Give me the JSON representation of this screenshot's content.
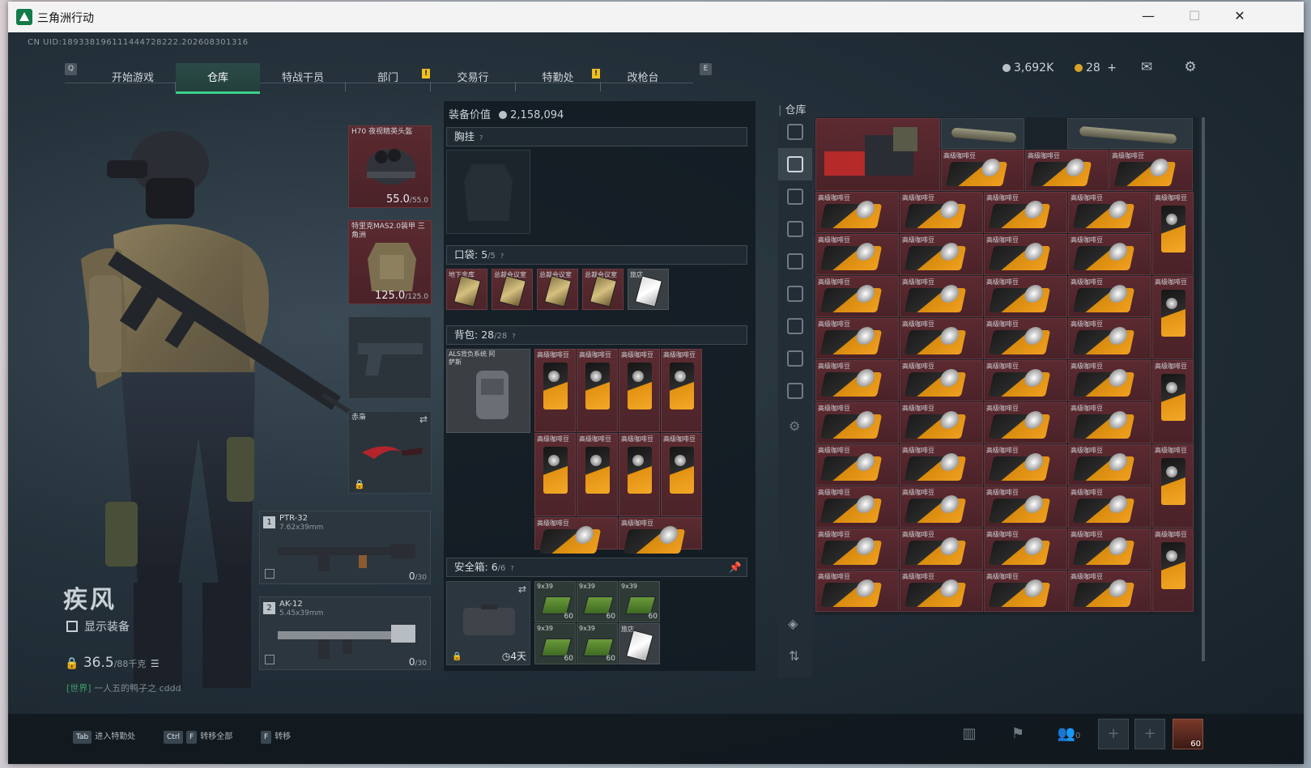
{
  "window": {
    "title": "三角洲行动",
    "min": "—",
    "max": "☐",
    "close": "✕"
  },
  "uid": "CN UID:189338196111444728222.202608301316",
  "nav": {
    "key_left": "Q",
    "key_right": "E",
    "tabs": [
      "开始游戏",
      "仓库",
      "特战干员",
      "部门",
      "交易行",
      "特勤处",
      "改枪台"
    ],
    "active": 1,
    "badge": "!"
  },
  "currency": {
    "silver": "3,692K",
    "gold": "28",
    "plus": "+"
  },
  "character": {
    "name": "疾风",
    "show_equipment": "显示装备",
    "weight": "36.5",
    "weight_max": "/88千克",
    "trade_hint": "[世界]",
    "trade_user": "一人五的鸭子之 cddd"
  },
  "gear": {
    "helmet": {
      "label": "H70 夜视精英头盔",
      "dur": "55.0",
      "max": "/55.0"
    },
    "armor": {
      "label": "特里克MAS2.0装甲 三角洲",
      "dur": "125.0",
      "max": "/125.0"
    },
    "melee": {
      "label": "赤枭"
    }
  },
  "weapons": [
    {
      "num": "1",
      "name": "PTR-32",
      "cal": "7.62x39mm",
      "ammo": "0",
      "max": "/30"
    },
    {
      "num": "2",
      "name": "AK-12",
      "cal": "5.45x39mm",
      "ammo": "0",
      "max": "/30"
    }
  ],
  "equip": {
    "value_label": "装备价值",
    "value": "2,158,094",
    "chest": "胸挂",
    "pockets_label": "口袋:",
    "pockets": "5",
    "pockets_max": "/5",
    "pocket_items": [
      "地下金库",
      "总裁会议室",
      "总裁会议室",
      "总裁会议室",
      "旅店"
    ],
    "backpack_label": "背包:",
    "backpack": "28",
    "backpack_max": "/28",
    "backpack_name": "ALS背负系统 阿萨斯",
    "bean_label": "高级咖啡豆",
    "safe_label": "安全箱:",
    "safe": "6",
    "safe_max": "/6",
    "safe_time": "4天",
    "safe_items": [
      {
        "t": "9x39",
        "n": "60"
      },
      {
        "t": "9x39",
        "n": "60"
      },
      {
        "t": "9x39",
        "n": "60"
      },
      {
        "t": "9x39",
        "n": "60"
      },
      {
        "t": "9x39",
        "n": "60"
      },
      {
        "t": "旅店",
        "n": ""
      }
    ]
  },
  "warehouse": {
    "title": "仓库",
    "bean_label": "高级咖啡豆"
  },
  "bottom": {
    "tab_key": "Tab",
    "tab_label": "进入特勤处",
    "ctrl_key": "Ctrl",
    "f_key": "F",
    "transfer_all": "转移全部",
    "f2_key": "F",
    "transfer": "转移",
    "friends": "0",
    "level": "60"
  },
  "colors": {
    "accent": "#3cd08a",
    "item_red": "#5c2a31",
    "gold": "#f0a020"
  }
}
